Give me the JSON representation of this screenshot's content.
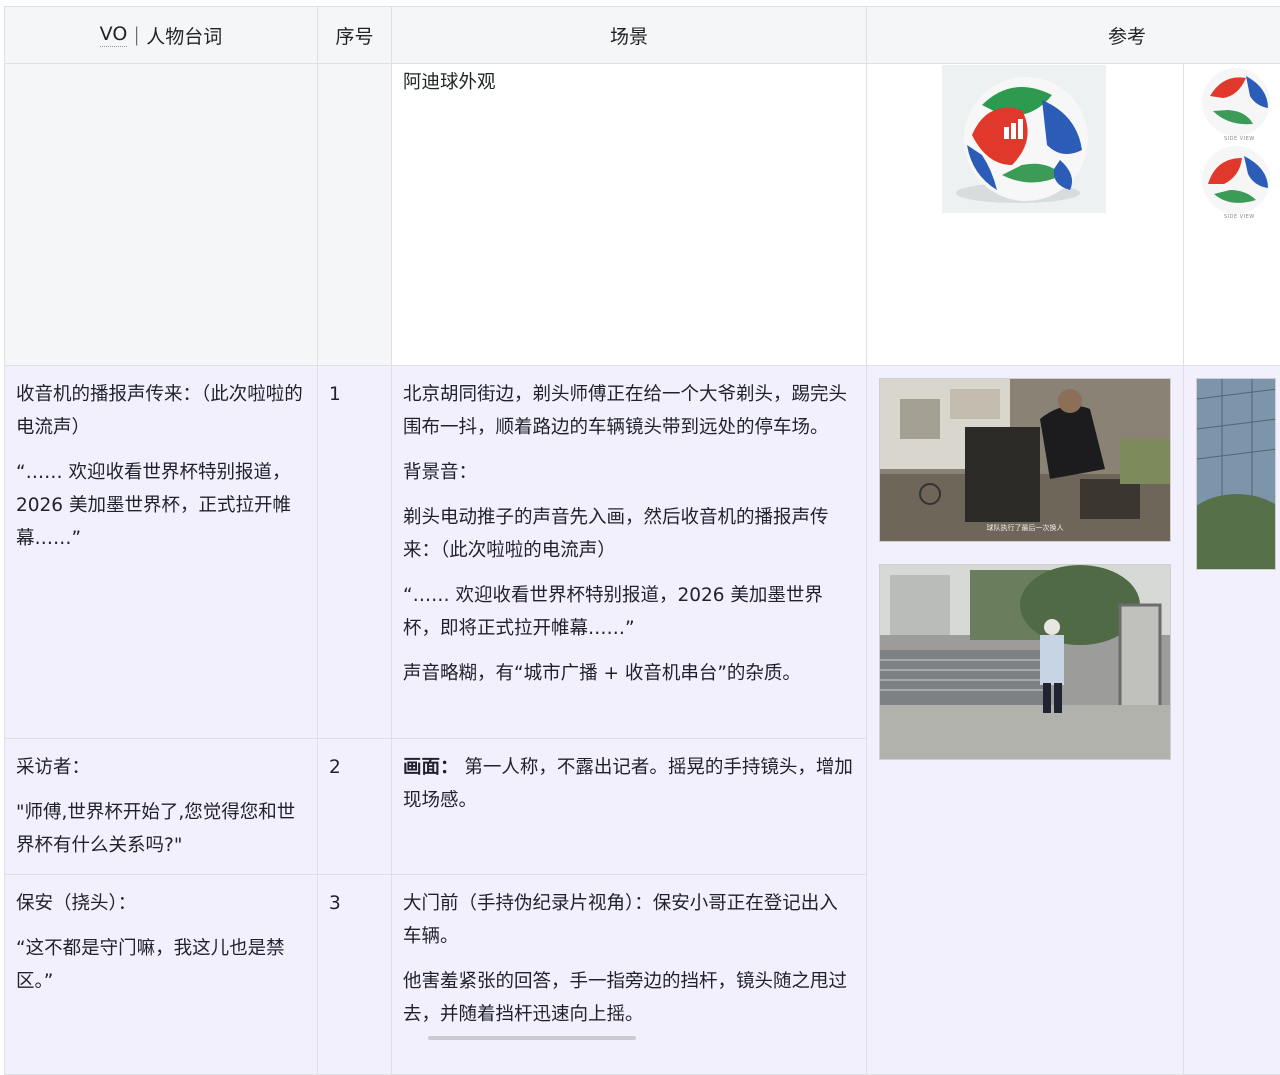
{
  "table": {
    "headers": {
      "vo_prefix": "VO",
      "vo_suffix": "｜人物台词",
      "index": "序号",
      "scene": "场景",
      "reference": "参考"
    },
    "rows": [
      {
        "vo": [],
        "index": "",
        "scene": [
          "阿迪球外观"
        ],
        "ball_side_label": "SIDE VIEW"
      },
      {
        "vo": [
          "收音机的播报声传来：（此次啦啦的电流声）",
          "“…… 欢迎收看世界杯特别报道，2026 美加墨世界杯，正式拉开帷幕……”"
        ],
        "index": "1",
        "scene": [
          "北京胡同街边，剃头师傅正在给一个大爷剃头，踢完头围布一抖，顺着路边的车辆镜头带到远处的停车场。",
          "背景音：",
          "剃头电动推子的声音先入画，然后收音机的播报声传来：（此次啦啦的电流声）",
          "“…… 欢迎收看世界杯特别报道，2026 美加墨世界杯，即将正式拉开帷幕……”",
          " 声音略糊，有“城市广播 + 收音机串台”的杂质。"
        ],
        "photo_caption": "球队执行了最后一次换人"
      },
      {
        "vo": [
          "采访者：",
          "\"师傅,世界杯开始了,您觉得您和世界杯有什么关系吗?\""
        ],
        "index": "2",
        "scene_bold": "画面：",
        "scene_rest": " 第一人称，不露出记者。摇晃的手持镜头，增加现场感。"
      },
      {
        "vo": [
          "保安（挠头）：",
          "“这不都是守门嘛，我这儿也是禁区。”"
        ],
        "index": "3",
        "scene": [
          "大门前（手持伪纪录片视角）：保安小哥正在登记出入车辆。",
          "他害羞紧张的回答，手一指旁边的挡杆，镜头随之甩过去，并随着挡杆迅速向上摇。"
        ]
      }
    ]
  },
  "colors": {
    "header_bg": "#f5f6f7",
    "selected_row_bg": "#f3f0fd",
    "border": "#dee0e3",
    "text": "#1f2329"
  }
}
